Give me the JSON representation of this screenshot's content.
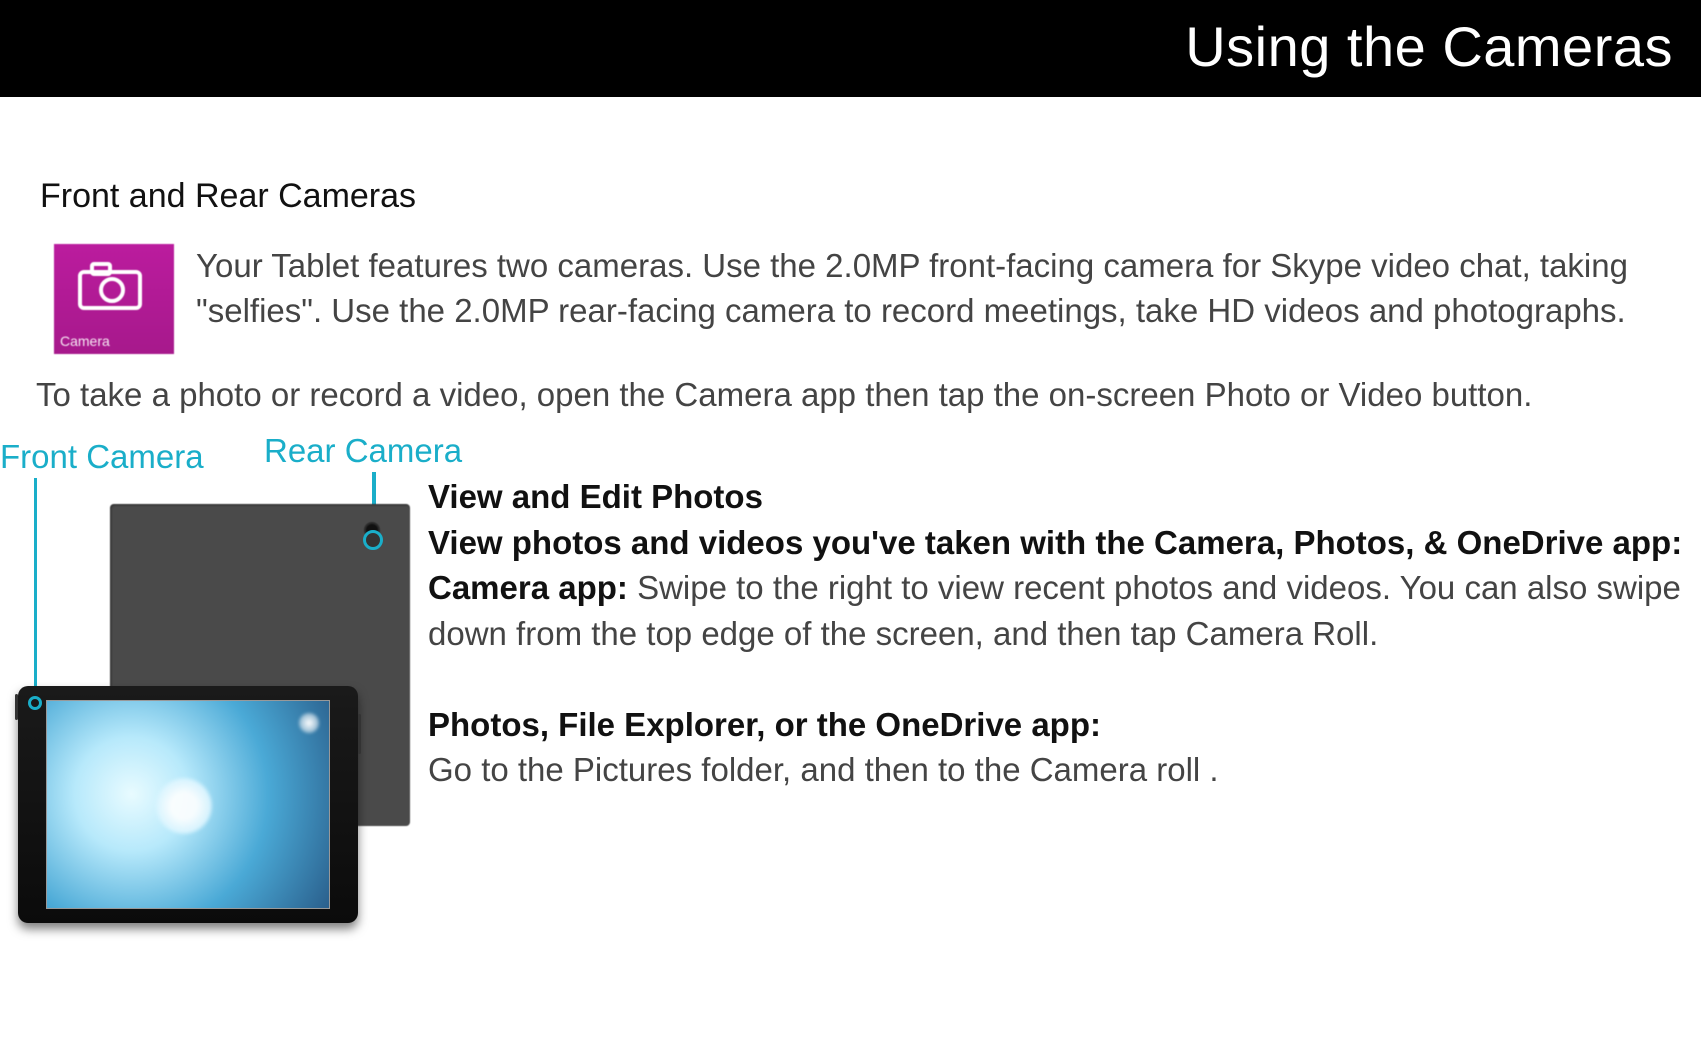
{
  "header": {
    "title": "Using the Cameras"
  },
  "section": {
    "heading": "Front and Rear Cameras"
  },
  "tile": {
    "label": "Camera"
  },
  "intro": {
    "text": "Your Tablet features two cameras. Use the 2.0MP front-facing camera for Skype video chat, taking \"selfies\". Use the 2.0MP rear-facing camera to record meetings, take HD videos and photographs."
  },
  "paragraph": {
    "text": "To take a photo or record a video, open the Camera app then tap the on-screen Photo or Video button."
  },
  "diagram": {
    "front_label": "Front Camera",
    "rear_label": "Rear Camera"
  },
  "right": {
    "h1": "View and Edit Photos",
    "h2": "View photos and videos you've taken with the Camera, Photos, & OneDrive app:",
    "camera_app_label": "Camera app:",
    "camera_app_text": " Swipe to the right to view recent photos and videos.  You can also swipe down from the top edge of the screen, and then tap Camera Roll.",
    "photos_label": "Photos, File Explorer, or the OneDrive app:",
    "photos_text": "Go to the Pictures folder, and then to the Camera roll ."
  }
}
